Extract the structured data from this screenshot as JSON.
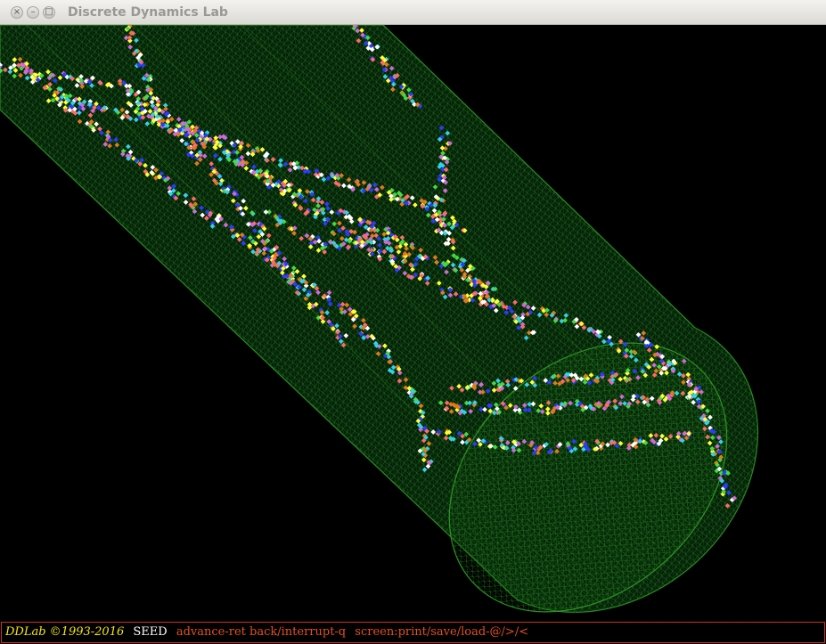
{
  "window": {
    "title": "Discrete Dynamics Lab",
    "buttons": {
      "close": "×",
      "minimize": "–",
      "maximize": "□"
    }
  },
  "colors": {
    "background": "#000000",
    "lattice": "#1f7d1a",
    "status_border": "#c8321e",
    "brand": "#f5e60a",
    "command": "#e6501e",
    "cells": [
      "#ffff33",
      "#2a3cff",
      "#35d0e8",
      "#46d846",
      "#ff6a6a",
      "#e07a1a",
      "#d06ad6",
      "#ffffff"
    ]
  },
  "status": {
    "brand": "DDLab ©1993-2016",
    "mode": "SEED",
    "advance": "advance-ret back/interrupt-q",
    "screen": "screen:print/save/load-@/>/<"
  }
}
